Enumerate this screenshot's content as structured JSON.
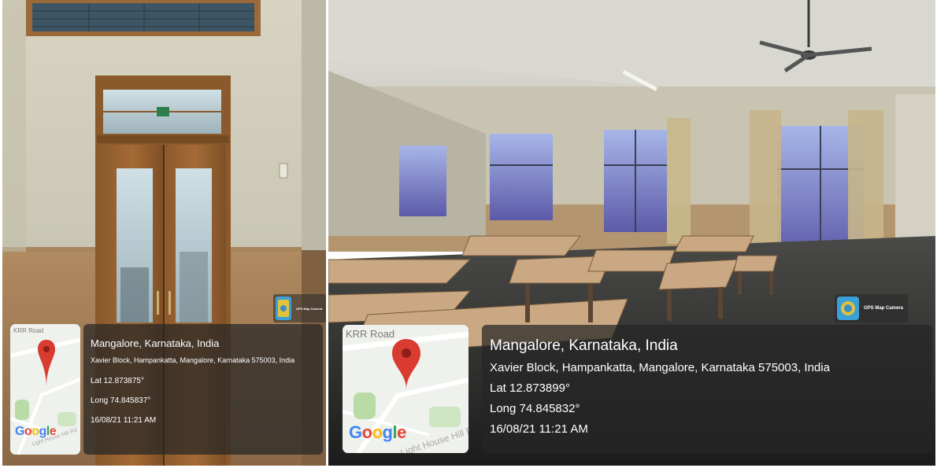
{
  "app_badge": {
    "label": "GPS Map Camera",
    "icon": "gps-map-camera-icon"
  },
  "left_photo": {
    "map": {
      "road_label": "KRR Road",
      "street_label": "Light House Hill Rd",
      "logo": "Google"
    },
    "overlay": {
      "place": "Mangalore, Karnataka, India",
      "address": "Xavier Block, Hampankatta, Mangalore, Karnataka 575003, India",
      "lat": "Lat 12.873875°",
      "long": "Long 74.845837°",
      "datetime": "16/08/21 11:21 AM"
    }
  },
  "right_photo": {
    "map": {
      "road_label": "KRR Road",
      "street_label": "Light House Hill Rd",
      "logo": "Google"
    },
    "overlay": {
      "place": "Mangalore, Karnataka, India",
      "address": "Xavier Block, Hampankatta, Mangalore, Karnataka 575003, India",
      "lat": "Lat 12.873899°",
      "long": "Long 74.845832°",
      "datetime": "16/08/21 11:21 AM"
    }
  },
  "colors": {
    "map_pin": "#d93b30",
    "google_blue": "#4285f4",
    "google_red": "#ea4335",
    "google_yellow": "#fbbc05",
    "google_green": "#34a853"
  }
}
